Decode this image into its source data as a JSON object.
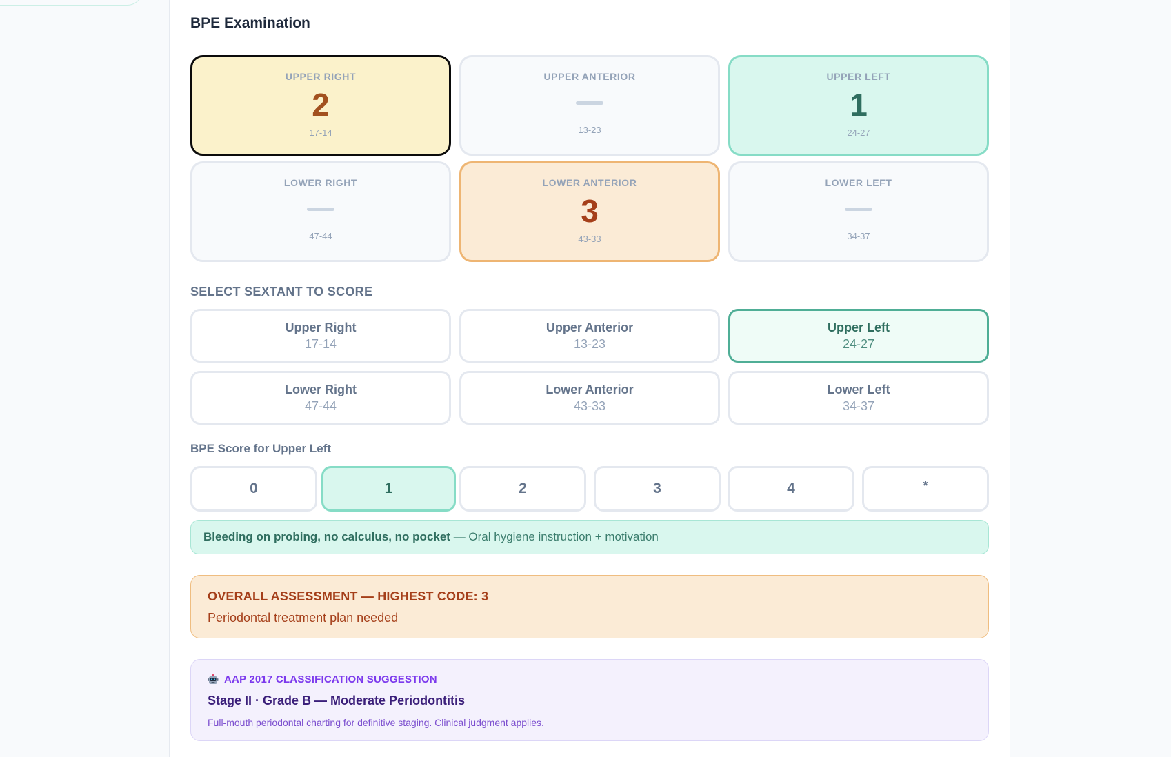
{
  "title": "BPE Examination",
  "sextants": [
    {
      "label": "UPPER RIGHT",
      "score": "2",
      "range": "17-14",
      "state": "scored-2"
    },
    {
      "label": "UPPER ANTERIOR",
      "score": null,
      "range": "13-23",
      "state": "empty"
    },
    {
      "label": "UPPER LEFT",
      "score": "1",
      "range": "24-27",
      "state": "scored-1"
    },
    {
      "label": "LOWER RIGHT",
      "score": null,
      "range": "47-44",
      "state": "empty"
    },
    {
      "label": "LOWER ANTERIOR",
      "score": "3",
      "range": "43-33",
      "state": "scored-3"
    },
    {
      "label": "LOWER LEFT",
      "score": null,
      "range": "34-37",
      "state": "empty"
    }
  ],
  "select": {
    "label": "SELECT SEXTANT TO SCORE",
    "options": [
      {
        "name": "Upper Right",
        "range": "17-14"
      },
      {
        "name": "Upper Anterior",
        "range": "13-23"
      },
      {
        "name": "Upper Left",
        "range": "24-27"
      },
      {
        "name": "Lower Right",
        "range": "47-44"
      },
      {
        "name": "Lower Anterior",
        "range": "43-33"
      },
      {
        "name": "Lower Left",
        "range": "34-37"
      }
    ],
    "selected": "Upper Left"
  },
  "score": {
    "label": "BPE Score for Upper Left",
    "buttons": [
      "0",
      "1",
      "2",
      "3",
      "4",
      "*"
    ],
    "selected": "1",
    "description_bold": "Bleeding on probing, no calculus, no pocket",
    "description_rest": " — Oral hygiene instruction + motivation"
  },
  "overall": {
    "heading": "OVERALL ASSESSMENT — HIGHEST CODE: 3",
    "text": "Periodontal treatment plan needed"
  },
  "aap": {
    "icon": "robot-icon",
    "heading": "AAP 2017 CLASSIFICATION SUGGESTION",
    "title": "Stage II · Grade B — Moderate Periodontitis",
    "footnote": "Full-mouth periodontal charting for definitive staging. Clinical judgment applies."
  },
  "colors": {
    "teal": "#2f6e5f",
    "amber_bg": "#fbf2cb",
    "orange": "#a53f1a",
    "purple": "#7c3aed"
  }
}
